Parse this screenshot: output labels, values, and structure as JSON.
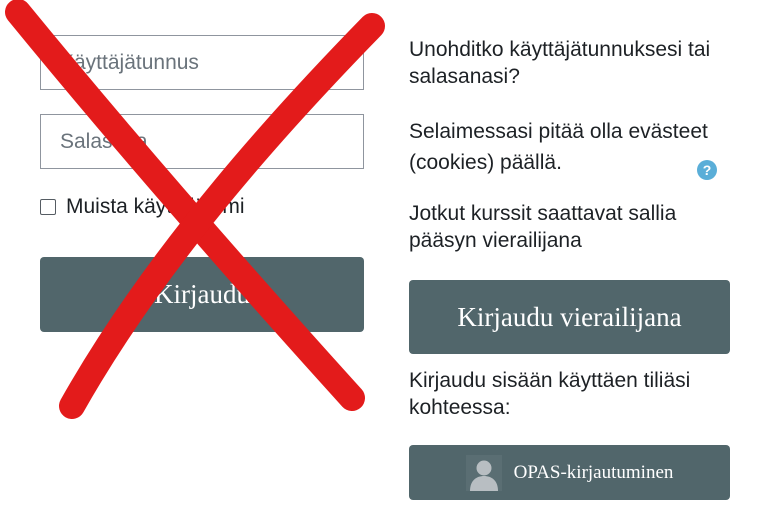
{
  "login": {
    "username_placeholder": "Käyttäjätunnus",
    "password_placeholder": "Salasana",
    "remember_label": "Muista käyttäjänimi",
    "login_button": "Kirjaudu"
  },
  "side": {
    "forgot_text": "Unohditko käyttäjätunnuksesi tai salasanasi?",
    "cookies_text": "Selaimessasi pitää olla evästeet (cookies) päällä.",
    "help_icon": "question-circle-icon",
    "guest_note": "Jotkut kurssit saattavat sallia pääsyn vierailijana",
    "guest_button": "Kirjaudu vierailijana",
    "idp_note": "Kirjaudu sisään käyttäen tiliäsi kohteessa:",
    "opas_button": "OPAS-kirjautuminen",
    "opas_icon": "user-avatar-icon"
  },
  "overlay": {
    "mark": "red-x-cross",
    "color": "#e31b1b"
  },
  "colors": {
    "button_bg": "#51666b",
    "help_icon": "#5aaed8"
  }
}
